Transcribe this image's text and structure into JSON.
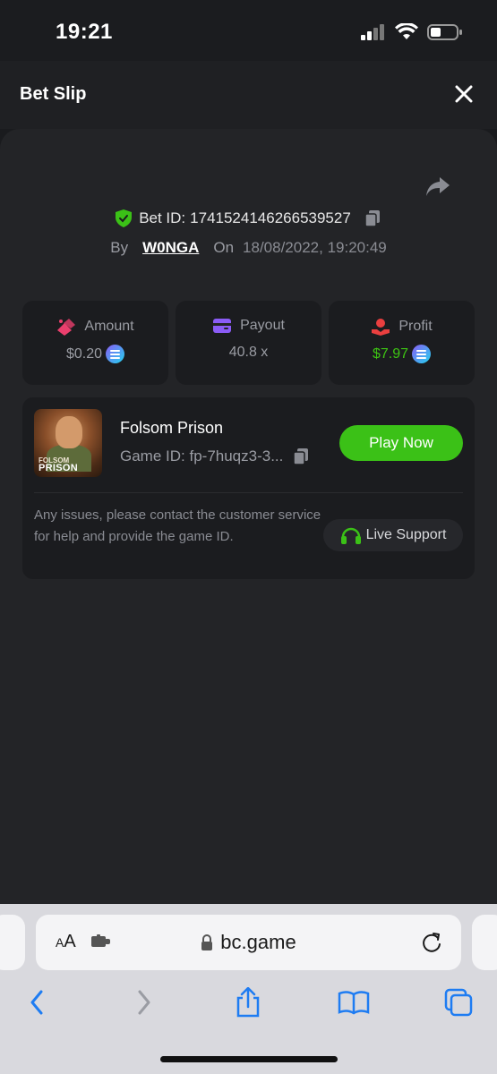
{
  "status_bar": {
    "time": "19:21"
  },
  "header": {
    "title": "Bet Slip"
  },
  "bet": {
    "id_label": "Bet ID:",
    "id_value": "1741524146266539527",
    "by_label": "By",
    "user": "W0NGA",
    "on_label": "On",
    "date": "18/08/2022, 19:20:49"
  },
  "stats": [
    {
      "label": "Amount",
      "value": "$0.20"
    },
    {
      "label": "Payout",
      "value": "40.8 x"
    },
    {
      "label": "Profit",
      "value": "$7.97"
    }
  ],
  "game": {
    "thumb_line1": "FOLSOM",
    "thumb_line2": "PRISON",
    "name": "Folsom Prison",
    "id_label": "Game ID:",
    "id_value": "fp-7huqz3-3...",
    "play_label": "Play Now",
    "issue_text": "Any issues, please contact the customer service for help and provide the game ID.",
    "support_label": "Live Support"
  },
  "browser": {
    "aa_small": "A",
    "aa_large": "A",
    "url": "bc.game"
  },
  "colors": {
    "accent_green": "#3bc117",
    "profit_green": "#3dc413",
    "background": "#232427"
  }
}
